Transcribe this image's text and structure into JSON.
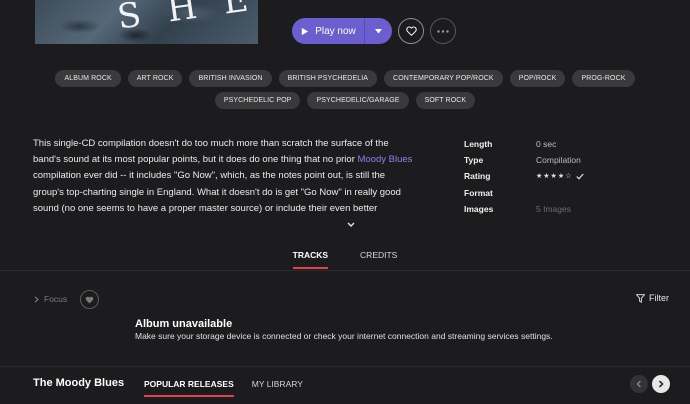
{
  "play": {
    "label": "Play now"
  },
  "tags": [
    "ALBUM ROCK",
    "ART ROCK",
    "BRITISH INVASION",
    "BRITISH PSYCHEDELIA",
    "CONTEMPORARY POP/ROCK",
    "POP/ROCK",
    "PROG-ROCK",
    "PSYCHEDELIC POP",
    "PSYCHEDELIC/GARAGE",
    "SOFT ROCK"
  ],
  "description": {
    "before_link": "This single-CD compilation doesn't do too much more than scratch the surface of the band's sound at its most popular points, but it does do one thing that no prior ",
    "link": "Moody Blues",
    "after_link": " compilation ever did -- it includes \"Go Now\", which, as the notes point out, is still the group's top-charting single in England. What it doesn't do is get \"Go Now\" in really good sound (no one seems to have a proper master source) or include their even better"
  },
  "meta": {
    "length": {
      "label": "Length",
      "value": "0 sec"
    },
    "type": {
      "label": "Type",
      "value": "Compilation"
    },
    "rating": {
      "label": "Rating",
      "stars": "★★★★☆",
      "rating_value": 4
    },
    "format": {
      "label": "Format",
      "value": ""
    },
    "images": {
      "label": "Images",
      "value": "5 Images"
    }
  },
  "tabs": {
    "tracks": "TRACKS",
    "credits": "CREDITS"
  },
  "focus": {
    "label": "Focus"
  },
  "filter": {
    "label": "Filter"
  },
  "unavailable": {
    "title": "Album unavailable",
    "message": "Make sure your storage device is connected or check your internet connection and streaming services settings."
  },
  "bottom": {
    "artist": "The Moody Blues",
    "tab_popular": "POPULAR RELEASES",
    "tab_library": "MY LIBRARY"
  },
  "colors": {
    "accent": "#6b5fd0",
    "link": "#8b82ef",
    "active_underline": "#e0434b",
    "background": "#1c1c1e"
  }
}
